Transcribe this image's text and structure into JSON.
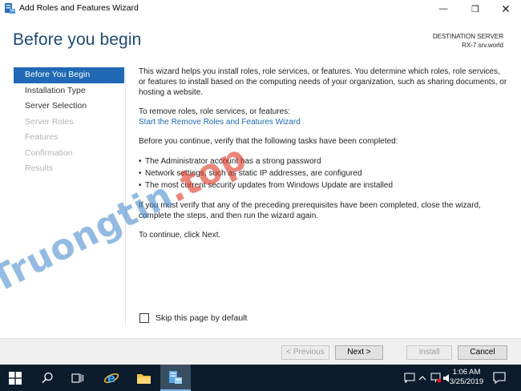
{
  "window": {
    "title": "Add Roles and Features Wizard",
    "minimize_glyph": "—",
    "maximize_glyph": "❐",
    "close_glyph": "✕"
  },
  "header": {
    "title": "Before you begin",
    "destination_label": "DESTINATION SERVER",
    "destination_server": "RX-7.srv.world"
  },
  "nav": {
    "items": [
      {
        "label": "Before You Begin",
        "state": "active"
      },
      {
        "label": "Installation Type",
        "state": "enabled"
      },
      {
        "label": "Server Selection",
        "state": "enabled"
      },
      {
        "label": "Server Roles",
        "state": "disabled"
      },
      {
        "label": "Features",
        "state": "disabled"
      },
      {
        "label": "Confirmation",
        "state": "disabled"
      },
      {
        "label": "Results",
        "state": "disabled"
      }
    ]
  },
  "content": {
    "intro": "This wizard helps you install roles, role services, or features. You determine which roles, role services, or features to install based on the computing needs of your organization, such as sharing documents, or hosting a website.",
    "remove_text": "To remove roles, role services, or features:",
    "remove_link": "Start the Remove Roles and Features Wizard",
    "verify_text": "Before you continue, verify that the following tasks have been completed:",
    "bullets": [
      "The Administrator account has a strong password",
      "Network settings, such as static IP addresses, are configured",
      "The most current security updates from Windows Update are installed"
    ],
    "prereq_text": "If you must verify that any of the preceding prerequisites have been completed, close the wizard, complete the steps, and then run the wizard again.",
    "continue_text": "To continue, click Next."
  },
  "skip_checkbox": {
    "label": "Skip this page by default",
    "checked": false
  },
  "footer": {
    "previous_label": "< Previous",
    "next_label": "Next >",
    "install_label": "Install",
    "cancel_label": "Cancel"
  },
  "taskbar": {
    "time": "1:06 AM",
    "date": "3/25/2019",
    "accent_color": "#1f69b5",
    "background_color": "#0c1c2c"
  },
  "watermark": {
    "text": "Truongtin",
    "suffix": ".top"
  }
}
